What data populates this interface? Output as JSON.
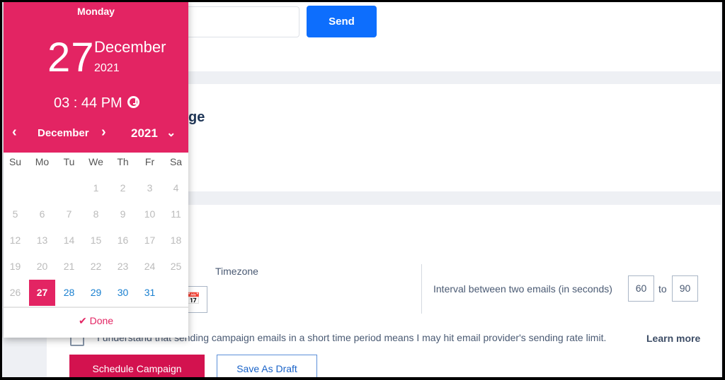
{
  "top": {
    "send_label": "Send"
  },
  "section2": {
    "title": "ge"
  },
  "schedule": {
    "timezone_label": "Timezone",
    "interval_label": "Interval between two emails (in seconds)",
    "interval_min": "60",
    "interval_to": "to",
    "interval_max": "90",
    "consent_label": "I understand that sending campaign emails in a short time period means I may hit email provider's sending rate limit.",
    "learn_more": "Learn more",
    "schedule_button": "Schedule Campaign",
    "draft_button": "Save As Draft"
  },
  "picker": {
    "weekday": "Monday",
    "day": "27",
    "month": "December",
    "year": "2021",
    "time": "03 : 44 PM",
    "nav_month": "December",
    "nav_year": "2021",
    "prev": "‹",
    "next": "›",
    "year_toggle": "⌄",
    "weekdays": [
      "Su",
      "Mo",
      "Tu",
      "We",
      "Th",
      "Fr",
      "Sa"
    ],
    "weeks": [
      [
        "",
        "",
        "",
        "1",
        "2",
        "3",
        "4"
      ],
      [
        "5",
        "6",
        "7",
        "8",
        "9",
        "10",
        "11"
      ],
      [
        "12",
        "13",
        "14",
        "15",
        "16",
        "17",
        "18"
      ],
      [
        "19",
        "20",
        "21",
        "22",
        "23",
        "24",
        "25"
      ],
      [
        "26",
        "27",
        "28",
        "29",
        "30",
        "31",
        ""
      ]
    ],
    "selected": "27",
    "selectable_from": 27,
    "done_label": "Done",
    "accent": "#e32463"
  }
}
